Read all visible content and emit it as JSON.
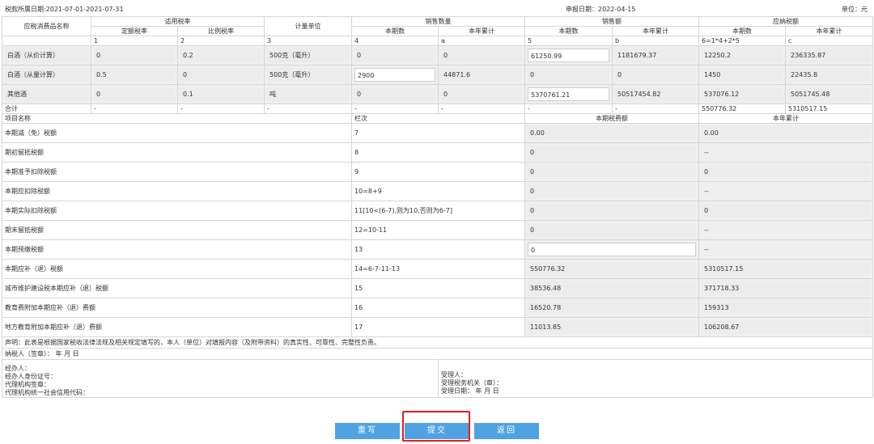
{
  "header": {
    "period": "税款所属日期:2021-07-01-2021-07-31",
    "report_date": "申报日期：2022-04-15",
    "unit": "单位：元"
  },
  "table_head": {
    "item_name": "应税消费品名称",
    "applicable_rate": "适用税率",
    "fixed_rate": "定额税率",
    "ratio_rate": "比例税率",
    "unit_col": "计量单位",
    "sales_qty": "销售数量",
    "sales_amt": "销售额",
    "tax_payable": "应纳税额",
    "current": "本期数",
    "ytd": "本年累计"
  },
  "index_row": [
    "1",
    "2",
    "3",
    "4",
    "a",
    "5",
    "b",
    "6=1*4+2*5",
    "c"
  ],
  "products": [
    {
      "name": "白酒（从价计算）",
      "fixed": "0",
      "ratio": "0.2",
      "unit": "500克（毫升）",
      "qty_cur": "0",
      "qty_ytd": "0",
      "amt_cur": "61250.99",
      "amt_ytd": "1181679.37",
      "tax_cur": "12250.2",
      "tax_ytd": "236335.87"
    },
    {
      "name": "白酒（从量计算）",
      "fixed": "0.5",
      "ratio": "0",
      "unit": "500克（毫升）",
      "qty_cur": "2900",
      "qty_ytd": "44871.6",
      "amt_cur": "0",
      "amt_ytd": "0",
      "tax_cur": "1450",
      "tax_ytd": "22435.8"
    },
    {
      "name": "其他酒",
      "fixed": "0",
      "ratio": "0.1",
      "unit": "吨",
      "qty_cur": "0",
      "qty_ytd": "0",
      "amt_cur": "5370761.21",
      "amt_ytd": "50517454.82",
      "tax_cur": "537076.12",
      "tax_ytd": "5051745.48"
    }
  ],
  "total": {
    "label": "合计",
    "dash": "-",
    "tax_cur": "550776.32",
    "tax_ytd": "5310517.15"
  },
  "lower_head": {
    "item": "项目名称",
    "line": "栏次",
    "current_tax": "本期税费额",
    "ytd": "本年累计"
  },
  "lines": [
    {
      "name": "本期减（免）税额",
      "line": "7",
      "cur": "0.00",
      "ytd": "0.00"
    },
    {
      "name": "期初留抵税额",
      "line": "8",
      "cur": "0",
      "ytd": "--"
    },
    {
      "name": "本期准予扣除税额",
      "line": "9",
      "cur": "0",
      "ytd": "0"
    },
    {
      "name": "本期应扣除税额",
      "line": "10=8+9",
      "cur": "0",
      "ytd": "--"
    },
    {
      "name": "本期实际扣除税额",
      "line": "11[10<(6-7),则为10,否则为6-7]",
      "cur": "0",
      "ytd": "0"
    },
    {
      "name": "期末留抵税额",
      "line": "12=10-11",
      "cur": "0",
      "ytd": "--"
    },
    {
      "name": "本期预缴税额",
      "line": "13",
      "cur": "0",
      "ytd": "--"
    },
    {
      "name": "本期应补（退）税额",
      "line": "14=6-7-11-13",
      "cur": "550776.32",
      "ytd": "5310517.15"
    },
    {
      "name": "城市维护建设税本期应补（退）税额",
      "line": "15",
      "cur": "38536.48",
      "ytd": "371718.33"
    },
    {
      "name": "教育费附加本期应补（退）费额",
      "line": "16",
      "cur": "16520.78",
      "ytd": "159313"
    },
    {
      "name": "地方教育附加本期应补（退）费额",
      "line": "17",
      "cur": "11013.85",
      "ytd": "106208.67"
    }
  ],
  "declaration": "声明：此表是根据国家税收法律法规及相关规定填写的，本人（单位）对填报内容（及附带资料）的真实性、可靠性、完整性负责。",
  "taxpayer_sign": "纳税人（签章）：          年    月    日",
  "agent_block": [
    "经办人：",
    "经办人身份证号：",
    "代理机构签章：",
    "代理机构统一社会信用代码："
  ],
  "receiver_block": [
    "受理人：",
    "受理税务机关（章）：",
    "受理日期：       年    月    日"
  ],
  "buttons": {
    "rewrite": "重写",
    "submit": "提交",
    "back": "返回"
  },
  "colors": {
    "button": "#4fa3e3",
    "highlight": "#e02020"
  }
}
